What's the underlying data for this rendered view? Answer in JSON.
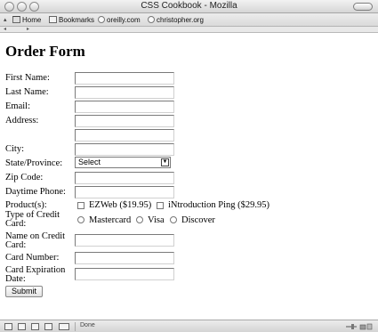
{
  "window": {
    "title": "CSS Cookbook - Mozilla"
  },
  "bookmarks": {
    "items": [
      "Home",
      "Bookmarks",
      "oreilly.com",
      "christopher.org"
    ]
  },
  "form": {
    "heading": "Order Form",
    "first_name_label": "First Name:",
    "last_name_label": "Last Name:",
    "email_label": "Email:",
    "address_label": "Address:",
    "city_label": "City:",
    "state_label": "State/Province:",
    "state_selected": "Select",
    "zip_label": "Zip Code:",
    "phone_label": "Daytime Phone:",
    "products_label": "Product(s):",
    "product_options": [
      "EZWeb ($19.95)",
      "iNtroduction Ping ($29.95)"
    ],
    "card_type_label_1": "Type of Credit",
    "card_type_label_2": "Card:",
    "card_types": [
      "Mastercard",
      "Visa",
      "Discover"
    ],
    "card_name_label_1": "Name on Credit",
    "card_name_label_2": "Card:",
    "card_number_label": "Card Number:",
    "expiration_label_1": "Card Expiration",
    "expiration_label_2": "Date:",
    "submit_label": "Submit"
  },
  "status": {
    "text": "Done"
  }
}
